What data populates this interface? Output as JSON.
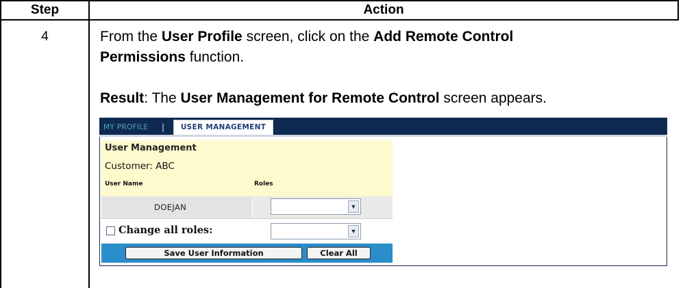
{
  "table": {
    "header": {
      "step": "Step",
      "action": "Action"
    },
    "row": {
      "step": "4",
      "line1": {
        "pre": "From the ",
        "b1": "User Profile",
        "mid": " screen, click on the ",
        "b2": "Add Remote Control"
      },
      "line2": {
        "b1": "Permissions",
        "post": " function."
      },
      "line3": {
        "b1": "Result",
        "mid1": ":  The ",
        "b2": "User Management for Remote Control",
        "post": " screen appears."
      }
    }
  },
  "screenshot": {
    "nav": {
      "tab1": "MY PROFILE",
      "separator": "|",
      "tab2": "USER MANAGEMENT"
    },
    "panel": {
      "title": "User Management",
      "customer": "Customer:  ABC",
      "col_username": "User Name",
      "col_roles": "Roles"
    },
    "user_row": {
      "username": "DOEJAN",
      "role_value": ""
    },
    "change_all": {
      "label": "Change all roles:",
      "checked": false,
      "role_value": ""
    },
    "buttons": {
      "save": "Save User Information",
      "clear": "Clear All"
    },
    "colors": {
      "navbar": "#0f2a52",
      "panel": "#fdfacd",
      "button_bar": "#2b8dc9",
      "tab_inactive_text": "#4fa7ad"
    },
    "icons": {
      "select_arrow": "chevron-down-icon"
    }
  }
}
